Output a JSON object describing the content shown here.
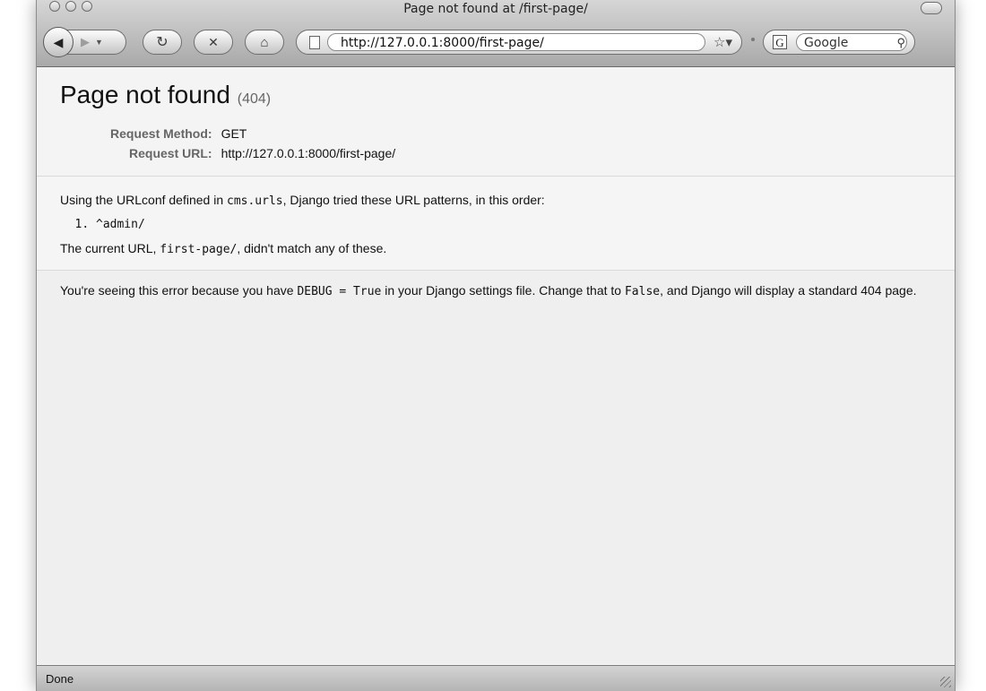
{
  "window": {
    "title": "Page not found at /first-page/"
  },
  "toolbar": {
    "back_icon": "back-arrow-icon",
    "forward_icon": "forward-arrow-icon",
    "reload_icon": "reload-icon",
    "stop_icon": "stop-icon",
    "home_icon": "home-icon",
    "url": "http://127.0.0.1:8000/first-page/",
    "search_placeholder": "Google"
  },
  "page": {
    "heading": "Page not found",
    "status_code": "(404)",
    "request_method_label": "Request Method:",
    "request_method": "GET",
    "request_url_label": "Request URL:",
    "request_url": "http://127.0.0.1:8000/first-page/",
    "info_prefix": "Using the URLconf defined in ",
    "urlconf": "cms.urls",
    "info_suffix": ", Django tried these URL patterns, in this order:",
    "patterns": [
      "^admin/"
    ],
    "current_prefix": "The current URL, ",
    "current_url": "first-page/",
    "current_suffix": ", didn't match any of these.",
    "explanation_prefix": "You're seeing this error because you have ",
    "debug_setting": "DEBUG = True",
    "explanation_middle": " in your Django settings file. Change that to ",
    "false_value": "False",
    "explanation_suffix": ", and Django will display a standard 404 page."
  },
  "status_bar": {
    "text": "Done"
  }
}
